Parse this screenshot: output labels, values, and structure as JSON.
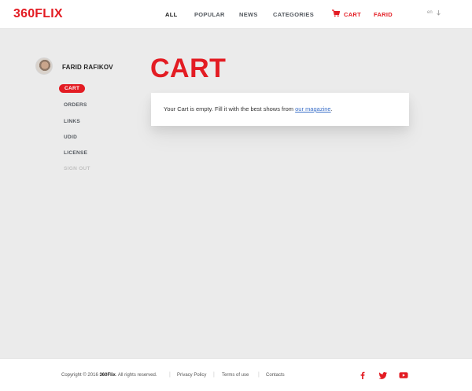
{
  "header": {
    "logo": "360FLIX",
    "nav": [
      {
        "label": "ALL"
      },
      {
        "label": "POPULAR"
      },
      {
        "label": "NEWS"
      },
      {
        "label": "CATEGORIES"
      }
    ],
    "cart_label": "CART",
    "user_label": "FARID",
    "lang": "en",
    "accent_color": "#e31c23"
  },
  "sidebar": {
    "user_name": "FARID RAFIKOV",
    "items": [
      {
        "label": "CART"
      },
      {
        "label": "ORDERS"
      },
      {
        "label": "LINKS"
      },
      {
        "label": "UDID"
      },
      {
        "label": "LICENSE"
      },
      {
        "label": "SIGN OUT"
      }
    ]
  },
  "main": {
    "title": "CART",
    "empty_text": "Your Cart is empty. Fill it with the best shows from ",
    "link_text": "our magazine",
    "trailing": "."
  },
  "footer": {
    "copyright_prefix": "Copyright © 2016 ",
    "brand": "360Flix",
    "copyright_suffix": ". All rights reserved.",
    "links": [
      {
        "label": "Privacy Policy"
      },
      {
        "label": "Terms of use"
      },
      {
        "label": "Contacts"
      }
    ],
    "social": [
      "facebook-icon",
      "twitter-icon",
      "youtube-icon"
    ]
  }
}
